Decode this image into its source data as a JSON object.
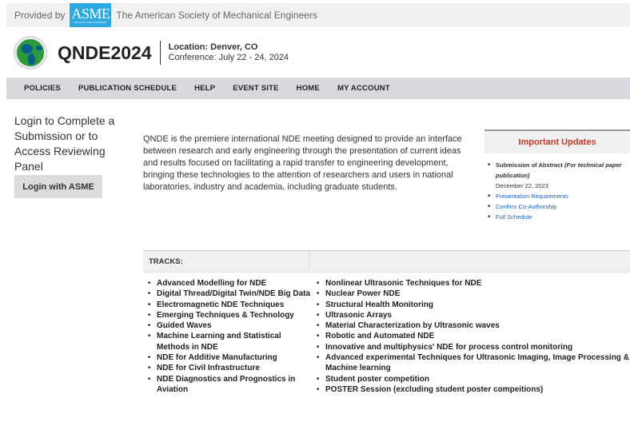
{
  "provided": {
    "prefix": "Provided by",
    "logo_text": "ASME",
    "logo_tagline": "SETTING THE STANDARD",
    "org_name": "The American Society of Mechanical Engineers"
  },
  "conference": {
    "title": "QNDE2024",
    "location": "Location: Denver, CO",
    "dates": "Conference: July 22 - 24, 2024"
  },
  "nav": {
    "items": [
      "POLICIES",
      "PUBLICATION SCHEDULE",
      "HELP",
      "EVENT SITE",
      "HOME",
      "MY ACCOUNT"
    ]
  },
  "login": {
    "title": "Login to Complete a Submission or to Access Reviewing Panel",
    "button_label": "Login with ASME"
  },
  "intro": {
    "text": "QNDE is the premiere international NDE meeting designed to provide an interface between research and early engineering through the presentation of current ideas and results focused on facilitating a rapid transfer to engineering development, bringing these technologies to the attention of researchers and users in national laboratories, industry and academia, including graduate students."
  },
  "updates": {
    "heading": "Important Updates",
    "abstract_label": "Submission of Abstract",
    "abstract_note": "(For technical paper publication)",
    "abstract_date": "December 22, 2023",
    "links": [
      "Presentation Requirements",
      "Confirm Co-Authorship",
      "Full Schedule"
    ]
  },
  "tracks": {
    "heading": "TRACKS:",
    "col1": [
      "Advanced Modelling for NDE",
      "Digital Thread/Digital Twin/NDE Big Data",
      "Electromagnetic NDE Techniques",
      "Emerging Techniques & Technology",
      "Guided Waves",
      "Machine Learning and Statistical Methods in NDE",
      "NDE for Additive Manufacturing",
      "NDE for Civil Infrastructure",
      "NDE Diagnostics and Prognostics in Aviation"
    ],
    "col2": [
      "Nonlinear Ultrasonic Techniques for NDE",
      "Nuclear Power NDE",
      "Structural Health Monitoring",
      "Ultrasonic Arrays",
      "Material Characterization by Ultrasonic waves",
      "Robotic and Automated NDE",
      "Innovative and multiphysics' NDE for process control monitoring",
      "Advanced experimental Techniques for Ultrasonic Imaging, Image Processing & Machine learning",
      "Student poster competition",
      "POSTER Session (excluding student poster compeitions)"
    ]
  },
  "colors": {
    "asme_blue": "#2da9e1",
    "updates_red": "#c0392b",
    "link_blue": "#1a5fb4",
    "nav_bg": "#d7d9dc"
  }
}
